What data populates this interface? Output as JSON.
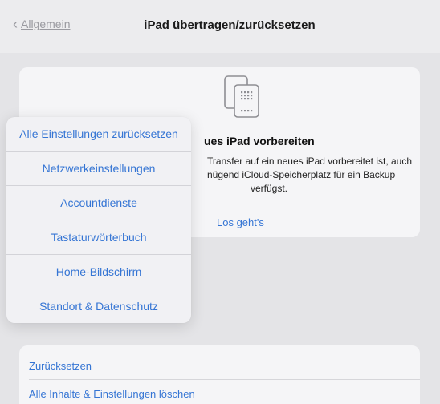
{
  "navbar": {
    "back_label": "Allgemein",
    "title": "iPad übertragen/zurücksetzen"
  },
  "prepare_card": {
    "icon": "ipad-transfer-icon",
    "title": "ues iPad vorbereiten",
    "description_lines": [
      "Transfer auf ein neues iPad vorbereitet ist, auch",
      "nügend iCloud-Speicherplatz für ein Backup",
      "verfügst."
    ],
    "link": "Los geht's"
  },
  "reset_popup": {
    "items": [
      "Alle Einstellungen zurücksetzen",
      "Netzwerkeinstellungen",
      "Accountdienste",
      "Tastaturwörterbuch",
      "Home-Bildschirm",
      "Standort & Datenschutz"
    ]
  },
  "reset_card": {
    "items": [
      "Zurücksetzen",
      "Alle Inhalte & Einstellungen löschen"
    ]
  },
  "colors": {
    "accent": "#3575d4",
    "background": "#e4e4e7",
    "card": "#f5f5f7"
  }
}
